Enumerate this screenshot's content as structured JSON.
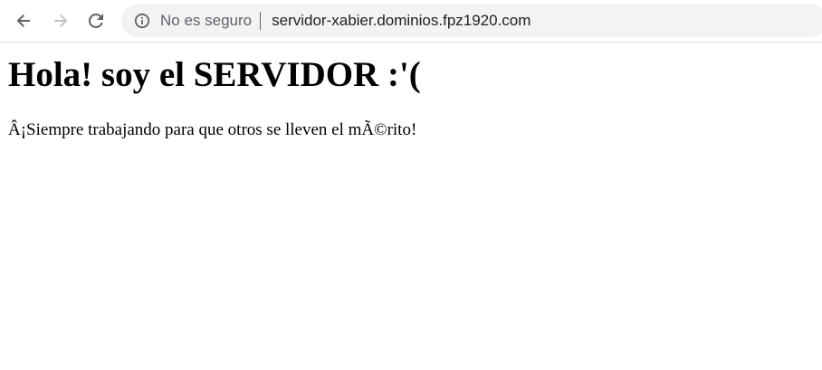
{
  "toolbar": {
    "icons": {
      "back": "arrow-left-icon",
      "forward": "arrow-right-icon",
      "reload": "reload-icon",
      "info": "info-circle-icon"
    },
    "colors": {
      "icon_active": "#5f6368",
      "icon_disabled": "#bdc1c6",
      "omnibox_bg": "#f1f3f4"
    },
    "security_label": "No es seguro",
    "url": "servidor-xabier.dominios.fpz1920.com"
  },
  "page": {
    "heading": "Hola! soy el SERVIDOR :'(",
    "message": "Â¡Siempre trabajando para que otros se lleven el mÃ©rito!"
  }
}
